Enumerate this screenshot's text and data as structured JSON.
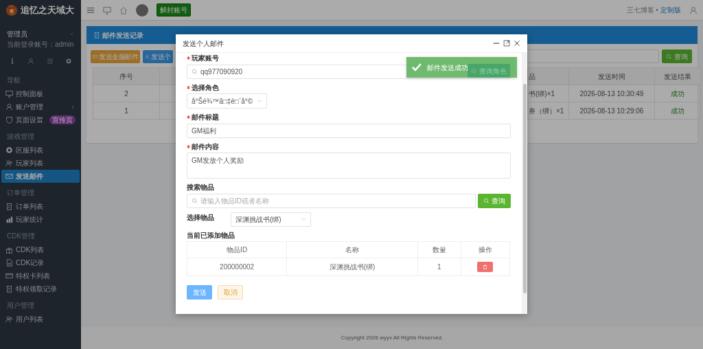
{
  "brand": {
    "title": "追忆之天域大"
  },
  "user": {
    "name": "管理员",
    "account": "当前登录账号：admin"
  },
  "user_tools": [
    {
      "kind": "thermometer"
    },
    {
      "kind": "user"
    },
    {
      "kind": "alarm"
    },
    {
      "kind": "gear"
    }
  ],
  "sidebar": {
    "sections": [
      {
        "title": "导航",
        "items": [
          {
            "label": "控制面板",
            "kind": "monitor",
            "selected": false
          },
          {
            "label": "账户管理",
            "kind": "user",
            "selected": false,
            "submenu": true
          },
          {
            "label": "页面设置",
            "kind": "shield",
            "selected": false,
            "badge": "宣传页"
          }
        ]
      },
      {
        "title": "游戏管理",
        "items": [
          {
            "label": "区服列表",
            "kind": "globe",
            "selected": false
          },
          {
            "label": "玩家列表",
            "kind": "users",
            "selected": false
          },
          {
            "label": "发送邮件",
            "kind": "mail",
            "selected": true
          }
        ]
      },
      {
        "title": "订单管理",
        "items": [
          {
            "label": "订单列表",
            "kind": "clipboard",
            "selected": false
          },
          {
            "label": "玩家统计",
            "kind": "chart",
            "selected": false
          }
        ]
      },
      {
        "title": "CDK管理",
        "items": [
          {
            "label": "CDK列表",
            "kind": "gift",
            "selected": false
          },
          {
            "label": "CDK记录",
            "kind": "file",
            "selected": false
          },
          {
            "label": "特权卡列表",
            "kind": "card",
            "selected": false
          },
          {
            "label": "特权领取记录",
            "kind": "clipboard",
            "selected": false
          }
        ]
      },
      {
        "title": "用户管理",
        "items": [
          {
            "label": "用户列表",
            "kind": "users",
            "selected": false
          }
        ]
      }
    ]
  },
  "topbar": {
    "unban_button": "解封账号",
    "site_name": "三七博客 •",
    "edition": "定制版"
  },
  "page": {
    "title": "邮件发送记录",
    "buttons": [
      {
        "label": "发送全服邮件",
        "kind": "all"
      },
      {
        "label": "发送个",
        "kind": "personal"
      }
    ],
    "search_button": "查询",
    "table": {
      "columns": [
        {
          "label": "序号"
        },
        {
          "label": "品"
        },
        {
          "label": "发送时间"
        },
        {
          "label": "发送结果"
        }
      ],
      "rows": [
        {
          "index": "2",
          "item": "书(绑)×1",
          "time": "2026-08-13 10:30:49",
          "result": "成功"
        },
        {
          "index": "1",
          "item": "券（绑）×1",
          "time": "2026-08-13 10:29:06",
          "result": "成功"
        }
      ]
    }
  },
  "footer": "Copyright 2026 wyyx All Rights Reserved.",
  "modal": {
    "title": "发送个人邮件",
    "player_account": {
      "label": "玩家账号",
      "required": true,
      "value": "qq977090920",
      "button": "查询角色"
    },
    "role": {
      "label": "选择角色",
      "required": true,
      "value": "å°Šé¾™ã□‡è□¨å°©"
    },
    "mail_title": {
      "label": "邮件标题",
      "required": true,
      "value": "GM福利"
    },
    "mail_content": {
      "label": "邮件内容",
      "required": true,
      "value": "GM发放个人奖励"
    },
    "item_search": {
      "label": "搜索物品",
      "placeholder": "请输入物品ID或者名称",
      "button": "查询"
    },
    "item_select": {
      "label": "选择物品",
      "value": "深渊挑战书(绑)"
    },
    "added_items": {
      "title": "当前已添加物品",
      "columns": [
        {
          "label": "物品ID"
        },
        {
          "label": "名称"
        },
        {
          "label": "数量"
        },
        {
          "label": "操作"
        }
      ],
      "rows": [
        {
          "id": "200000002",
          "name": "深渊挑战书(绑)",
          "quantity": "1"
        }
      ]
    },
    "send_button": "发送",
    "cancel_button": "取消"
  },
  "toast": {
    "message": "邮件发送成功"
  }
}
